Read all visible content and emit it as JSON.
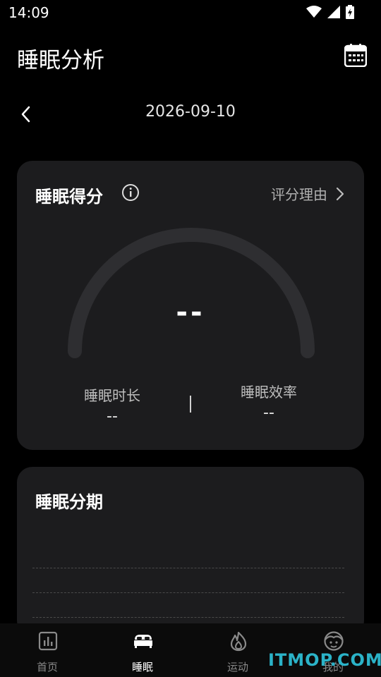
{
  "status_bar": {
    "time": "14:09"
  },
  "header": {
    "title": "睡眠分析"
  },
  "date_nav": {
    "date": "2026-09-10"
  },
  "score_card": {
    "title": "睡眠得分",
    "reason_link": "评分理由",
    "score": "--",
    "metrics": [
      {
        "label": "睡眠时长",
        "value": "--"
      },
      {
        "label": "睡眠效率",
        "value": "--"
      }
    ]
  },
  "stage_card": {
    "title": "睡眠分期"
  },
  "bottom_nav": {
    "items": [
      {
        "label": "首页",
        "icon": "chart-icon"
      },
      {
        "label": "睡眠",
        "icon": "bed-icon",
        "active": true
      },
      {
        "label": "运动",
        "icon": "flame-icon"
      },
      {
        "label": "我的",
        "icon": "face-icon"
      }
    ]
  },
  "watermark": "ITMOP.COM",
  "colors": {
    "background": "#000000",
    "card": "#1c1c1e",
    "gauge_track": "#2e2e31",
    "watermark": "#2bb3c8"
  }
}
